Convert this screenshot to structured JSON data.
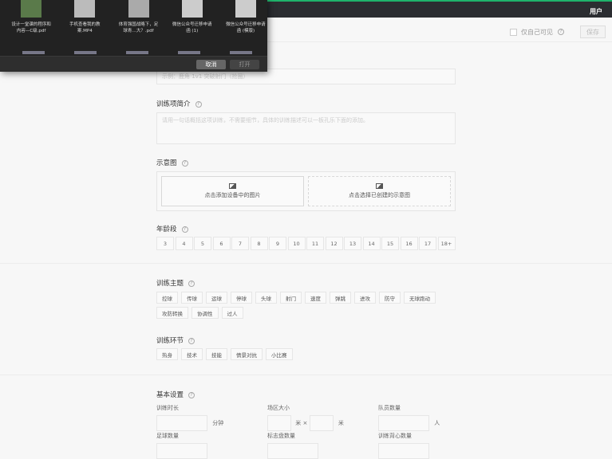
{
  "header": {
    "user": "用户"
  },
  "toolbar": {
    "private_label": "仅自己可见",
    "save_label": "保存"
  },
  "form": {
    "title_placeholder": "示例：鹿角 1v1 突破射门（抢圈）",
    "intro_label": "训练项简介",
    "intro_placeholder": "请用一句话概括这项训练，不需要细节，具体的训练描述可以一板孔乐下面的添加。",
    "diagram_label": "示意图",
    "upload_label": "点击添加设备中的图片",
    "select_label": "点击选择已创建的示意图",
    "age_label": "年龄段",
    "ages": [
      "3",
      "4",
      "5",
      "6",
      "7",
      "8",
      "9",
      "10",
      "11",
      "12",
      "13",
      "14",
      "15",
      "16",
      "17",
      "18+"
    ],
    "theme_label": "训练主题",
    "themes": [
      "控球",
      "传球",
      "运球",
      "停球",
      "头球",
      "射门",
      "速度",
      "弹跳",
      "进攻",
      "防守",
      "无球跑动",
      "攻防转换",
      "协调性",
      "过人"
    ],
    "stage_label": "训练环节",
    "stages": [
      "热身",
      "技术",
      "技能",
      "情景对抗",
      "小比赛"
    ],
    "basic_label": "基本设置",
    "duration_label": "训练时长",
    "duration_unit": "分钟",
    "field_label": "场区大小",
    "meter": "米",
    "times": "×",
    "players_label": "队员数量",
    "players_unit": "人",
    "balls_label": "足球数量",
    "cones_label": "标志盘数量",
    "vests_label": "训练背心数量"
  },
  "dialog": {
    "files": [
      "设计一堂课的程序和内容—C级.pdf",
      "手机查看我的教案.MP4",
      "体育强国战略下，足球青…大？.pdf",
      "微信公众号迁移申请函 (1)",
      "微信公众号迁移申请函 (模版)"
    ],
    "cancel": "取消",
    "open": "打开"
  }
}
